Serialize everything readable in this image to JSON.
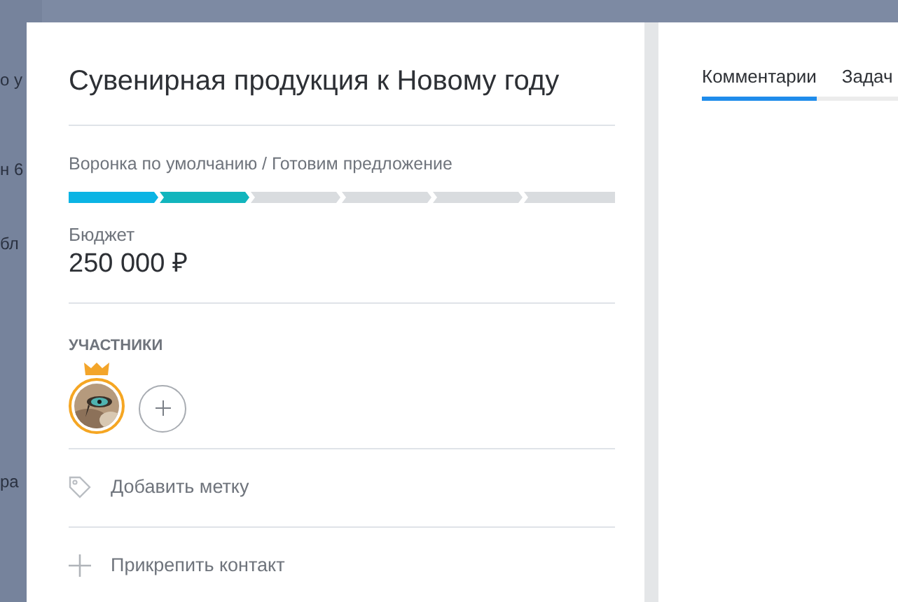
{
  "background_fragments": [
    "о у",
    "н 6",
    "бл",
    "ра"
  ],
  "deal": {
    "title": "Сувенирная продукция к Новому году",
    "pipeline_path": "Воронка по умолчанию / Готовим предложение",
    "stages": [
      {
        "color": "#0bb4e4"
      },
      {
        "color": "#12b5bd"
      },
      {
        "color": "#d9dcdf"
      },
      {
        "color": "#d9dcdf"
      },
      {
        "color": "#d9dcdf"
      },
      {
        "color": "#d9dcdf"
      }
    ],
    "budget_label": "Бюджет",
    "budget_value": "250 000 ₽",
    "participants_label": "УЧАСТНИКИ",
    "participants": [
      {
        "kind": "picture",
        "owner": true
      }
    ],
    "actions": [
      {
        "kind": "tag",
        "label": "Добавить метку"
      },
      {
        "kind": "plus",
        "label": "Прикрепить контакт"
      }
    ]
  },
  "tabs": [
    {
      "label": "Комментарии",
      "selected": true
    },
    {
      "label": "Задач",
      "selected": false
    }
  ]
}
